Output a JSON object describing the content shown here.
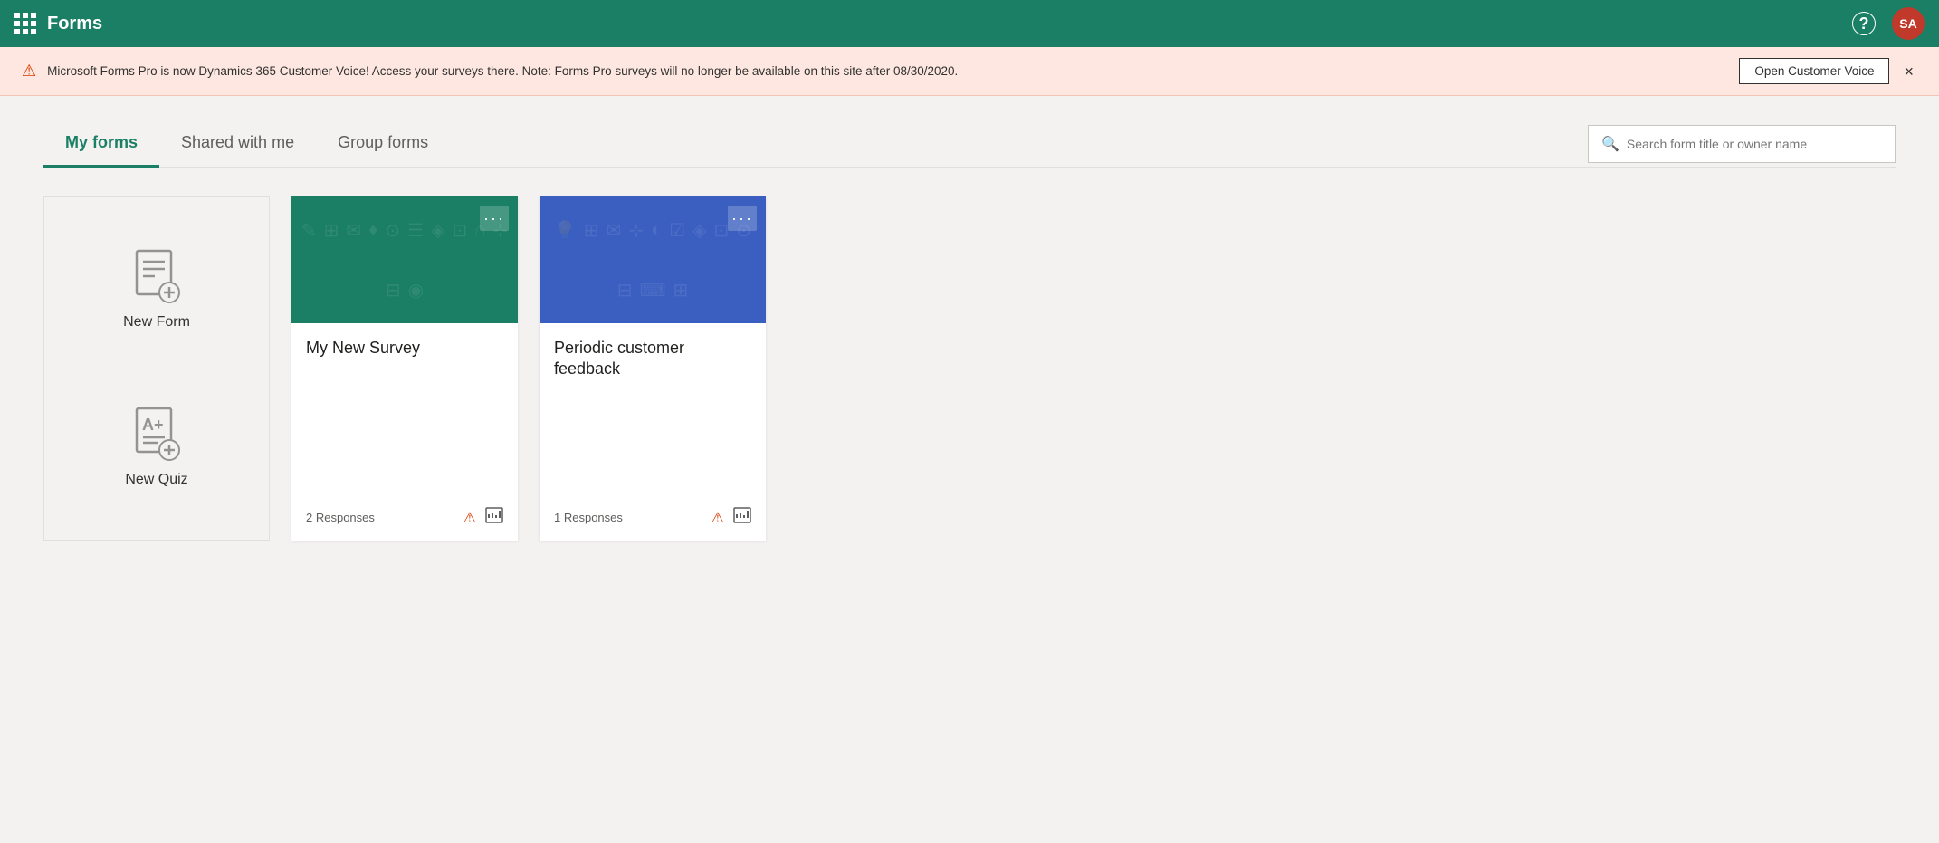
{
  "app": {
    "title": "Forms"
  },
  "header": {
    "help_label": "?",
    "avatar_initials": "SA"
  },
  "banner": {
    "text": "Microsoft Forms Pro is now Dynamics 365 Customer Voice! Access your surveys there. Note: Forms Pro surveys will no longer be available on this site after 08/30/2020.",
    "open_cv_label": "Open Customer Voice",
    "close_label": "×"
  },
  "tabs": {
    "items": [
      {
        "id": "my-forms",
        "label": "My forms",
        "active": true
      },
      {
        "id": "shared",
        "label": "Shared with me",
        "active": false
      },
      {
        "id": "group",
        "label": "Group forms",
        "active": false
      }
    ]
  },
  "search": {
    "placeholder": "Search form title or owner name"
  },
  "new_form": {
    "label": "New Form"
  },
  "new_quiz": {
    "label": "New Quiz"
  },
  "cards": [
    {
      "id": "survey1",
      "title": "My New Survey",
      "header_class": "card-header-green",
      "responses": "2 Responses"
    },
    {
      "id": "survey2",
      "title": "Periodic customer feedback",
      "header_class": "card-header-blue",
      "responses": "1 Responses"
    }
  ],
  "colors": {
    "nav_bg": "#1a7f64",
    "active_tab": "#1a7f64",
    "warning": "#d83b01",
    "card_green": "#1a7f64",
    "card_blue": "#3b5fc0"
  }
}
